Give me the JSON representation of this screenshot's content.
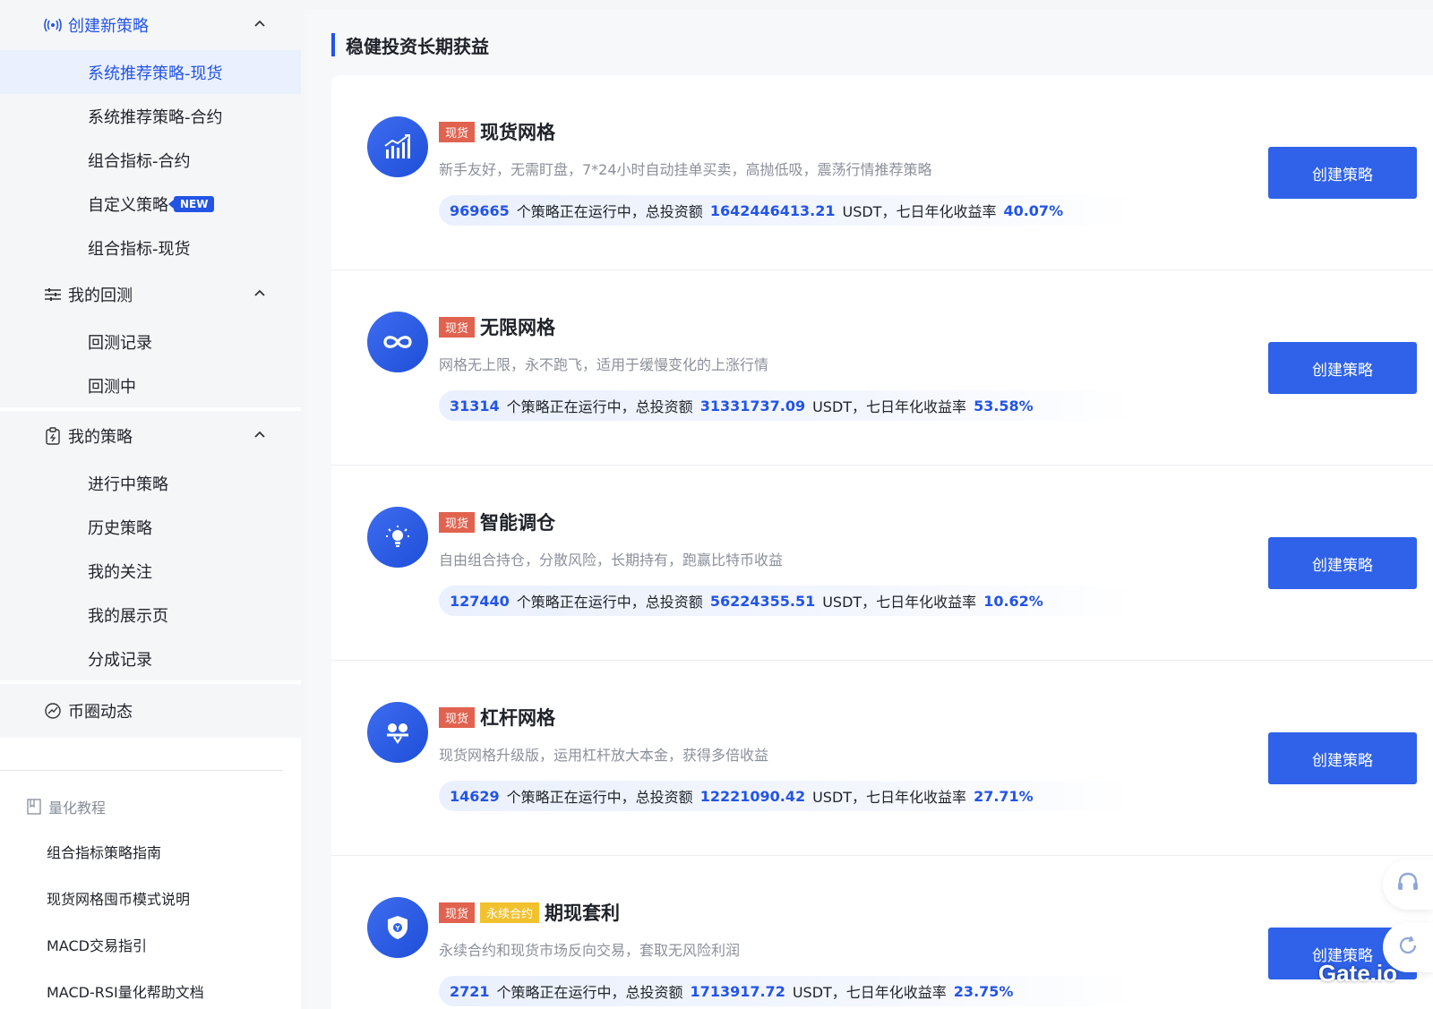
{
  "sidebar": {
    "create": {
      "label": "创建新策略",
      "items": [
        "系统推荐策略-现货",
        "系统推荐策略-合约",
        "组合指标-合约",
        "自定义策略",
        "组合指标-现货"
      ],
      "new_badge": "NEW"
    },
    "backtest": {
      "label": "我的回测",
      "items": [
        "回测记录",
        "回测中"
      ]
    },
    "mine": {
      "label": "我的策略",
      "items": [
        "进行中策略",
        "历史策略",
        "我的关注",
        "我的展示页",
        "分成记录"
      ]
    },
    "news": {
      "label": "币圈动态"
    },
    "tutorial": {
      "label": "量化教程",
      "items": [
        "组合指标策略指南",
        "现货网格囤币模式说明",
        "MACD交易指引",
        "MACD-RSI量化帮助文档"
      ]
    }
  },
  "main": {
    "section_title": "稳健投资长期获益",
    "stat_text": {
      "running": "个策略正在运行中，总投资额",
      "unit": "USDT，七日年化收益率"
    },
    "button_label": "创建策略",
    "cards": [
      {
        "icon": "chart-up-icon",
        "tags": [
          "现货"
        ],
        "name": "现货网格",
        "desc": "新手友好，无需盯盘，7*24小时自动挂单买卖，高抛低吸，震荡行情推荐策略",
        "count": "969665",
        "amount": "1642446413.21",
        "rate": "40.07%"
      },
      {
        "icon": "infinity-icon",
        "tags": [
          "现货"
        ],
        "name": "无限网格",
        "desc": "网格无上限，永不跑飞，适用于缓慢变化的上涨行情",
        "count": "31314",
        "amount": "31331737.09",
        "rate": "53.58%"
      },
      {
        "icon": "bulb-icon",
        "tags": [
          "现货"
        ],
        "name": "智能调仓",
        "desc": "自由组合持仓，分散风险，长期持有，跑赢比特币收益",
        "count": "127440",
        "amount": "56224355.51",
        "rate": "10.62%"
      },
      {
        "icon": "leverage-icon",
        "tags": [
          "现货"
        ],
        "name": "杠杆网格",
        "desc": "现货网格升级版，运用杠杆放大本金，获得多倍收益",
        "count": "14629",
        "amount": "12221090.42",
        "rate": "27.71%"
      },
      {
        "icon": "shield-icon",
        "tags": [
          "现货",
          "永续合约"
        ],
        "name": "期现套利",
        "desc": "永续合约和现货市场反向交易，套取无风险利润",
        "count": "2721",
        "amount": "1713917.72",
        "rate": "23.75%"
      }
    ]
  },
  "watermark": "Gate.io",
  "colors": {
    "accent": "#2354e6",
    "tag_red": "#e0624f",
    "tag_yellow": "#f2c12e"
  }
}
